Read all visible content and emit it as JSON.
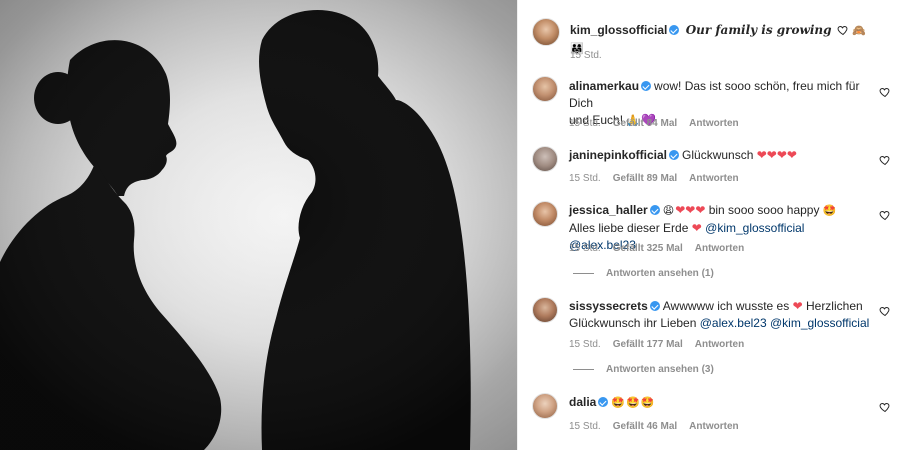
{
  "caption": {
    "username": "kim_glossofficial",
    "text": "Our family is growing",
    "emojis": "🙈👨‍👩‍👧",
    "time": "15 Std."
  },
  "comments": [
    {
      "username": "alinamerkau",
      "text_line1": "wow! Das ist sooo schön, freu mich für Dich",
      "text_line2": "und Euch! ",
      "emojis_line2": "🙏",
      "heart": "💜",
      "time": "15 Std.",
      "likes": "Gefällt 84 Mal",
      "reply": "Antworten"
    },
    {
      "username": "janinepinkofficial",
      "text_line1": "Glückwunsch ",
      "hearts": "❤❤❤❤",
      "time": "15 Std.",
      "likes": "Gefällt 89 Mal",
      "reply": "Antworten"
    },
    {
      "username": "jessica_haller",
      "emojis_pre": "😩",
      "hearts": "❤❤❤",
      "text_line1": " bin sooo sooo happy ",
      "emojis_post": "🤩",
      "text_line2": "Alles liebe dieser Erde ",
      "heart2": "❤",
      "mention1": "@kim_glossofficial",
      "mention2": "@alex.bel23",
      "time": "15 Std.",
      "likes": "Gefällt 325 Mal",
      "reply": "Antworten",
      "view_replies": "Antworten ansehen (1)"
    },
    {
      "username": "sissyssecrets",
      "text_line1": "Awwwww ich wusste es ",
      "heart": "❤",
      "text_line1b": " Herzlichen",
      "text_line2": "Glückwunsch ihr Lieben ",
      "mention1": "@alex.bel23",
      "mention2": "@kim_glossofficial",
      "time": "15 Std.",
      "likes": "Gefällt 177 Mal",
      "reply": "Antworten",
      "view_replies": "Antworten ansehen (3)"
    },
    {
      "username": "dalia",
      "emojis": "🤩🤩🤩",
      "time": "15 Std.",
      "likes": "Gefällt 46 Mal",
      "reply": "Antworten"
    }
  ],
  "icons": {
    "verified": "verified-badge-icon",
    "like": "heart-outline-icon"
  },
  "colors": {
    "verified": "#3897f0",
    "mention": "#00376b",
    "meta": "#8e8e8e",
    "heart_red": "#ed4956"
  }
}
